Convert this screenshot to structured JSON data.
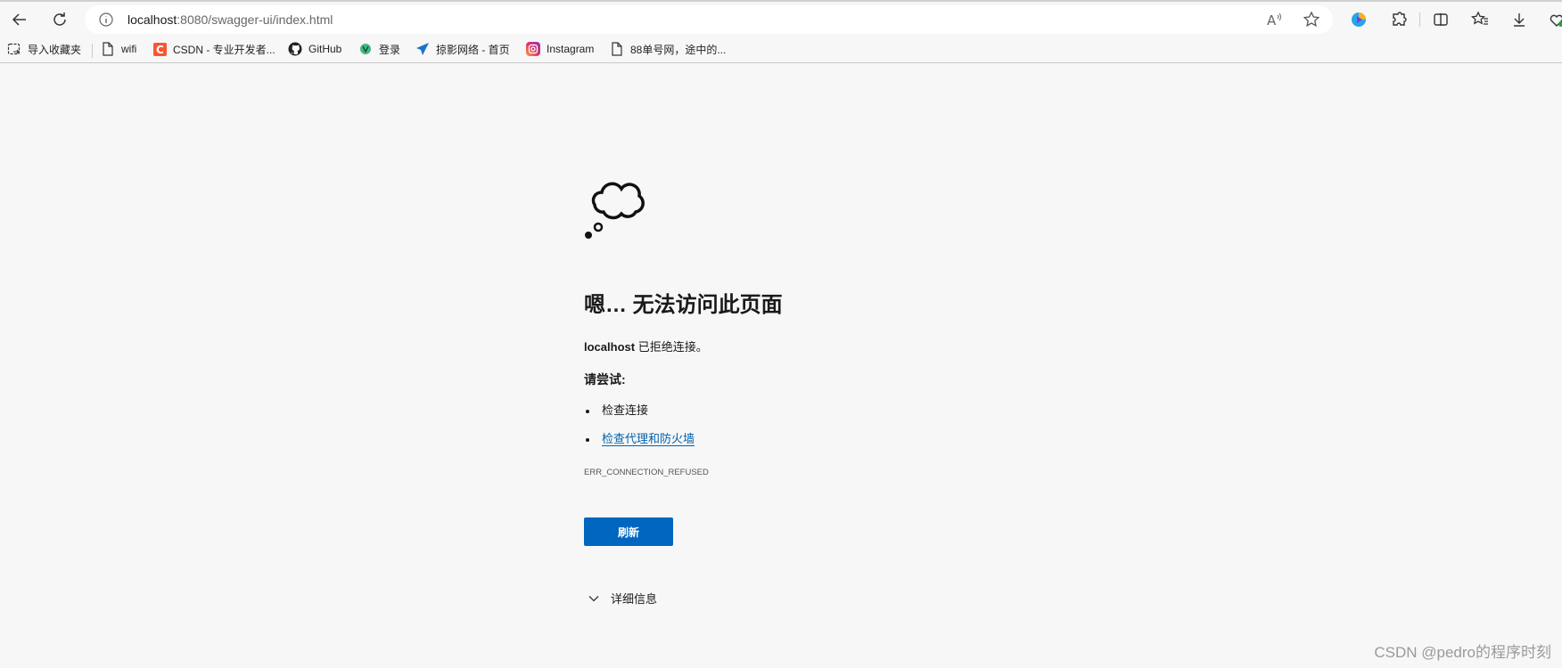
{
  "browser": {
    "address_bar": {
      "host": "localhost",
      "path": ":8080/swagger-ui/index.html"
    },
    "icons": [
      "back-icon",
      "refresh-icon",
      "site-info-icon",
      "read-aloud-icon",
      "favorite-star-icon",
      "copilot-icon",
      "extensions-icon",
      "split-screen-icon",
      "favorites-icon",
      "downloads-icon",
      "browser-essentials-icon"
    ]
  },
  "bookmarks": [
    {
      "label": "导入收藏夹",
      "icon": "import-icon"
    },
    {
      "label": "wifi",
      "icon": "page-icon"
    },
    {
      "label": "CSDN - 专业开发者...",
      "icon": "csdn-icon"
    },
    {
      "label": "GitHub",
      "icon": "github-icon"
    },
    {
      "label": "登录",
      "icon": "vue-icon"
    },
    {
      "label": "掠影网络 - 首页",
      "icon": "paper-plane-icon"
    },
    {
      "label": "Instagram",
      "icon": "instagram-icon"
    },
    {
      "label": "88单号网，途中的...",
      "icon": "page-icon"
    }
  ],
  "error_page": {
    "title": "嗯… 无法访问此页面",
    "host": "localhost",
    "message": " 已拒绝连接。",
    "try_label": "请尝试:",
    "suggestions": [
      "检查连接",
      "检查代理和防火墙"
    ],
    "error_code": "ERR_CONNECTION_REFUSED",
    "refresh_label": "刷新",
    "details_label": "详细信息"
  },
  "watermark": "CSDN @pedro的程序时刻",
  "colors": {
    "accent": "#0067c0",
    "link": "#0062ad",
    "background": "#f7f7f7"
  }
}
